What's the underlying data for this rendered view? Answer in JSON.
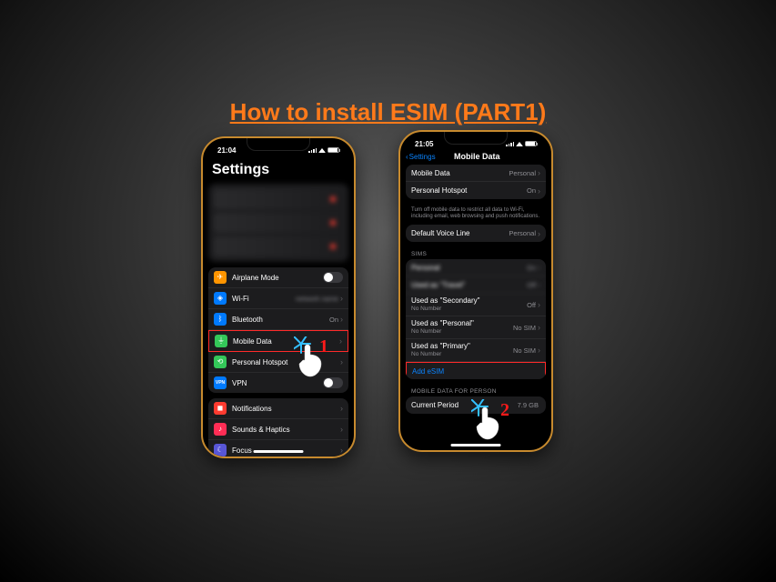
{
  "title": "How to install ESIM (PART1)",
  "phone1": {
    "time": "21:04",
    "screenTitle": "Settings",
    "group1": {
      "airplane": {
        "label": "Airplane Mode",
        "iconColor": "#ff9500"
      },
      "wifi": {
        "label": "Wi-Fi",
        "value": "",
        "iconColor": "#007aff"
      },
      "bluetooth": {
        "label": "Bluetooth",
        "value": "On",
        "iconColor": "#007aff"
      },
      "mobileData": {
        "label": "Mobile Data",
        "iconColor": "#34c759"
      },
      "hotspot": {
        "label": "Personal Hotspot",
        "iconColor": "#34c759"
      },
      "vpn": {
        "label": "VPN",
        "iconColor": "#007aff"
      }
    },
    "group2": {
      "notifications": {
        "label": "Notifications",
        "iconColor": "#ff3b30"
      },
      "sounds": {
        "label": "Sounds & Haptics",
        "iconColor": "#ff2d55"
      },
      "focus": {
        "label": "Focus",
        "iconColor": "#5856d6"
      }
    },
    "stepNumber": "1"
  },
  "phone2": {
    "time": "21:05",
    "backLabel": "Settings",
    "screenTitle": "Mobile Data",
    "top": {
      "mobileData": {
        "label": "Mobile Data",
        "value": "Personal"
      },
      "hotspot": {
        "label": "Personal Hotspot",
        "value": "On"
      },
      "helpText": "Turn off mobile data to restrict all data to Wi-Fi, including email, web browsing and push notifications."
    },
    "voice": {
      "label": "Default Voice Line",
      "value": "Personal"
    },
    "simsLabel": "SIMs",
    "sims": [
      {
        "label": "Personal",
        "value": "On",
        "blurred": true
      },
      {
        "label": "Used as \"Travel\"",
        "value": "Off",
        "blurred": true
      },
      {
        "label": "Used as \"Secondary\"",
        "sub": "No Number",
        "value": "Off"
      },
      {
        "label": "Used as \"Personal\"",
        "sub": "No Number",
        "value": "No SIM"
      },
      {
        "label": "Used as \"Primary\"",
        "sub": "No Number",
        "value": "No SIM"
      }
    ],
    "addEsim": "Add eSIM",
    "usageLabel": "MOBILE DATA FOR PERSON",
    "currentPeriod": {
      "label": "Current Period",
      "value": "7.9 GB"
    },
    "stepNumber": "2"
  }
}
